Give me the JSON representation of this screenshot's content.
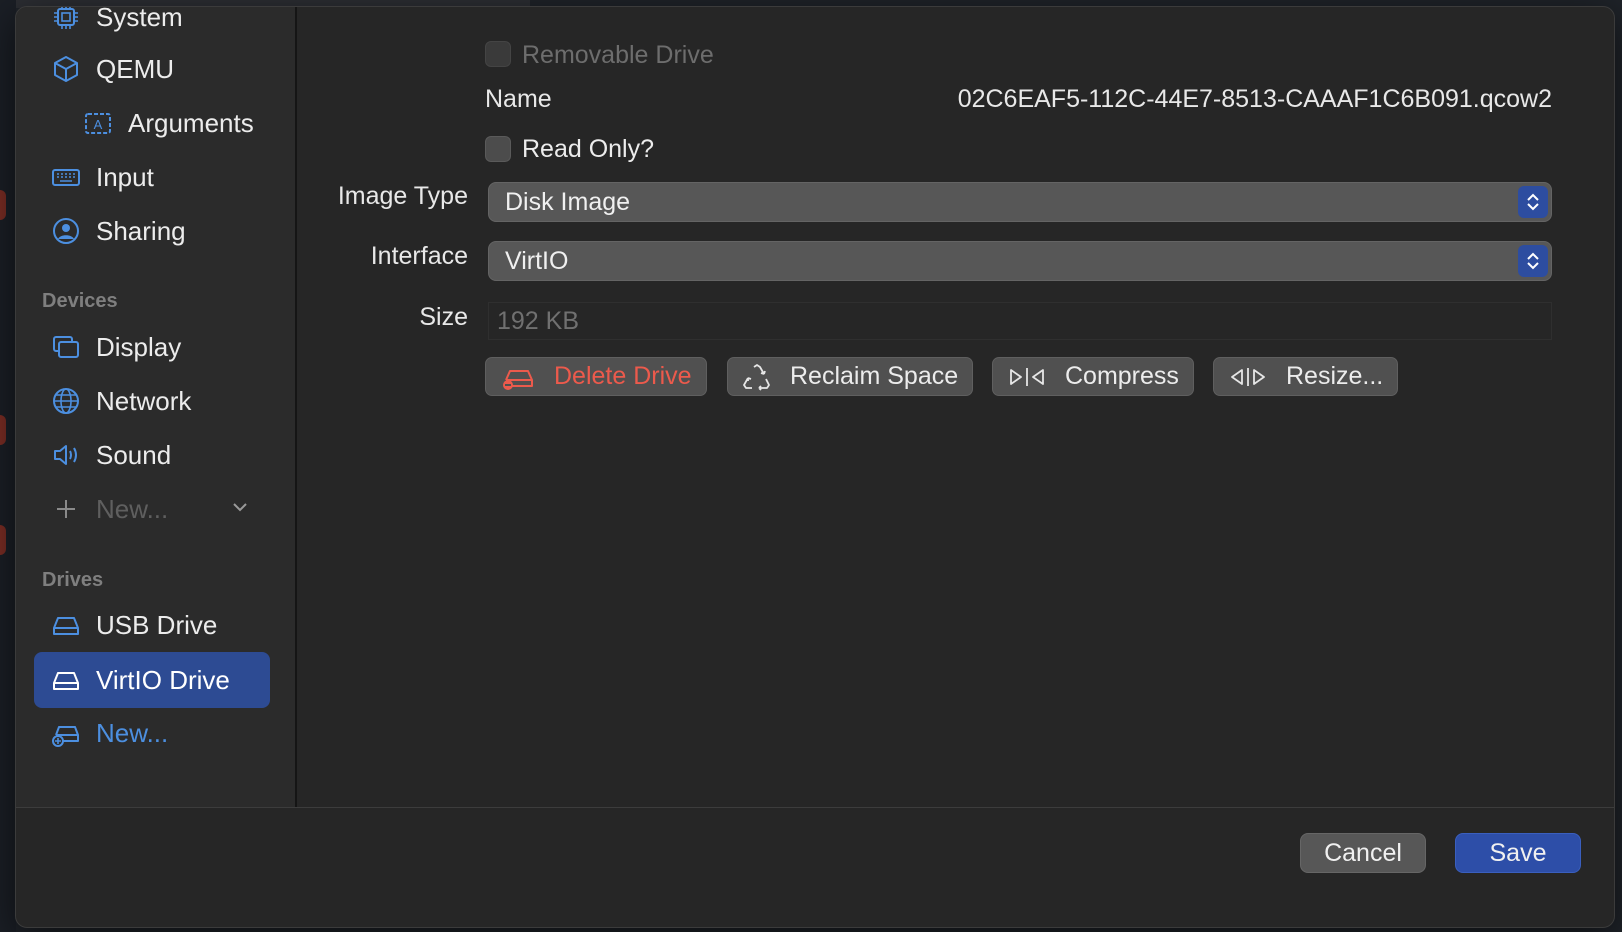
{
  "sidebar": {
    "items_top": [
      {
        "label": "System",
        "icon": "cpu-icon"
      },
      {
        "label": "QEMU",
        "icon": "cube-icon"
      },
      {
        "label": "Arguments",
        "icon": "arguments-icon"
      },
      {
        "label": "Input",
        "icon": "keyboard-icon"
      },
      {
        "label": "Sharing",
        "icon": "person-circle-icon"
      }
    ],
    "devices_header": "Devices",
    "devices": [
      {
        "label": "Display",
        "icon": "display-icon"
      },
      {
        "label": "Network",
        "icon": "globe-icon"
      },
      {
        "label": "Sound",
        "icon": "speaker-icon"
      }
    ],
    "new_device": "New...",
    "drives_header": "Drives",
    "drives": [
      {
        "label": "USB Drive",
        "icon": "drive-icon"
      },
      {
        "label": "VirtIO Drive",
        "icon": "drive-icon",
        "selected": true
      }
    ],
    "new_drive": "New..."
  },
  "form": {
    "removable_label": "Removable Drive",
    "name_label": "Name",
    "name_value": "02C6EAF5-112C-44E7-8513-CAAAF1C6B091.qcow2",
    "readonly_label": "Read Only?",
    "image_type_label": "Image Type",
    "image_type_value": "Disk Image",
    "interface_label": "Interface",
    "interface_value": "VirtIO",
    "size_label": "Size",
    "size_placeholder": "192 KB"
  },
  "actions": {
    "delete": "Delete Drive",
    "reclaim": "Reclaim Space",
    "compress": "Compress",
    "resize": "Resize..."
  },
  "footer": {
    "cancel": "Cancel",
    "save": "Save"
  },
  "colors": {
    "accent": "#2d4ea8",
    "selected": "#2d4b93",
    "danger": "#ec5a4c",
    "link": "#4c8fe0"
  }
}
